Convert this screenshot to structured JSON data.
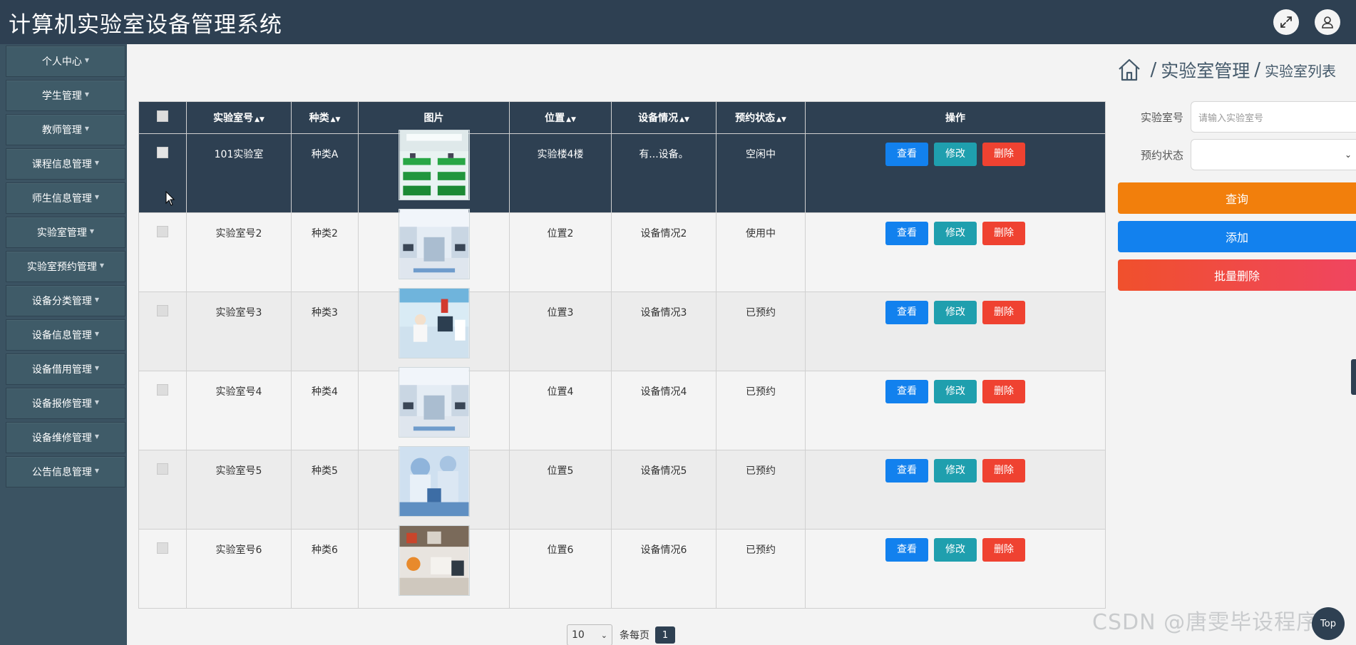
{
  "header": {
    "title": "计算机实验室设备管理系统"
  },
  "sidebar": {
    "items": [
      {
        "label": "个人中心"
      },
      {
        "label": "学生管理"
      },
      {
        "label": "教师管理"
      },
      {
        "label": "课程信息管理"
      },
      {
        "label": "师生信息管理"
      },
      {
        "label": "实验室管理"
      },
      {
        "label": "实验室预约管理"
      },
      {
        "label": "设备分类管理"
      },
      {
        "label": "设备信息管理"
      },
      {
        "label": "设备借用管理"
      },
      {
        "label": "设备报修管理"
      },
      {
        "label": "设备维修管理"
      },
      {
        "label": "公告信息管理"
      }
    ]
  },
  "breadcrumb": {
    "section": "实验室管理",
    "page": "实验室列表",
    "sep": "/"
  },
  "table": {
    "headers": [
      "实验室号",
      "种类",
      "图片",
      "位置",
      "设备情况",
      "预约状态",
      "操作"
    ],
    "rows": [
      {
        "lab_no": "101实验室",
        "kind": "种类A",
        "location": "实验楼4楼",
        "equipment": "有...设备。",
        "status": "空闲中"
      },
      {
        "lab_no": "实验室号2",
        "kind": "种类2",
        "location": "位置2",
        "equipment": "设备情况2",
        "status": "使用中"
      },
      {
        "lab_no": "实验室号3",
        "kind": "种类3",
        "location": "位置3",
        "equipment": "设备情况3",
        "status": "已预约"
      },
      {
        "lab_no": "实验室号4",
        "kind": "种类4",
        "location": "位置4",
        "equipment": "设备情况4",
        "status": "已预约"
      },
      {
        "lab_no": "实验室号5",
        "kind": "种类5",
        "location": "位置5",
        "equipment": "设备情况5",
        "status": "已预约"
      },
      {
        "lab_no": "实验室号6",
        "kind": "种类6",
        "location": "位置6",
        "equipment": "设备情况6",
        "status": "已预约"
      }
    ],
    "actions": {
      "view": "查看",
      "edit": "修改",
      "delete": "删除"
    }
  },
  "search": {
    "lab_label": "实验室号",
    "lab_placeholder": "请输入实验室号",
    "status_label": "预约状态",
    "status_value": "",
    "query_button": "查询",
    "add_button": "添加",
    "batch_delete_button": "批量删除"
  },
  "pagination": {
    "page_size": "10",
    "per_page_label": "条每页",
    "current_page": "1"
  },
  "watermark": "CSDN @唐雯毕设程序",
  "top_button": "Top",
  "colors": {
    "header_bg": "#2e4052",
    "sidebar_bg": "#3b5362",
    "view_btn": "#1281ee",
    "edit_btn": "#1f9fae",
    "delete_btn": "#ef4231",
    "query_btn": "#f27f0c",
    "add_btn": "#1281ee",
    "batch_delete_btn": "#f24d3a"
  }
}
